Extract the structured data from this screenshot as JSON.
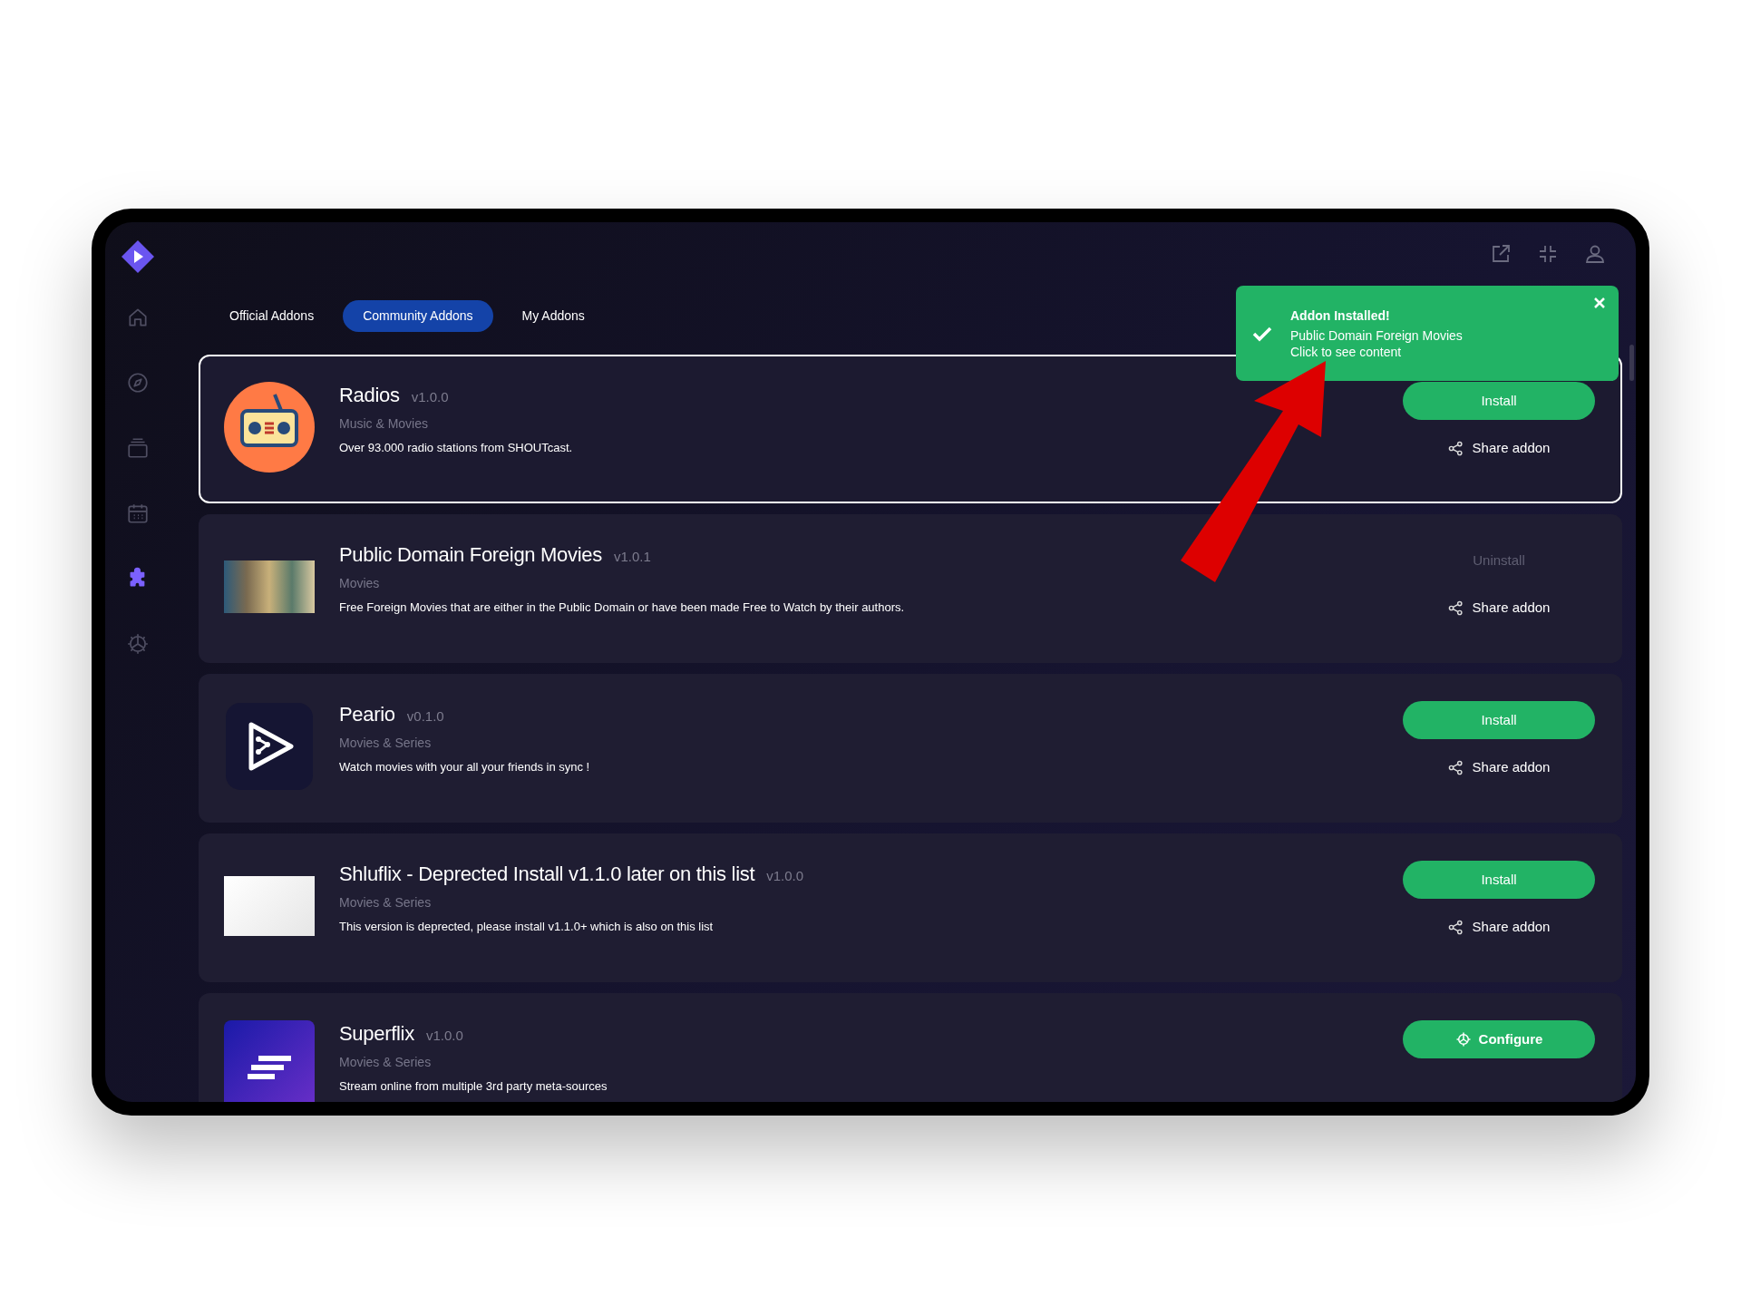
{
  "sidebar": {
    "items": [
      {
        "kind": "home",
        "selected": false
      },
      {
        "kind": "discover",
        "selected": false
      },
      {
        "kind": "library",
        "selected": false
      },
      {
        "kind": "calendar",
        "selected": false
      },
      {
        "kind": "addons",
        "selected": true
      },
      {
        "kind": "settings",
        "selected": false
      }
    ]
  },
  "tabs": [
    {
      "label": "Official Addons",
      "selected": false
    },
    {
      "label": "Community Addons",
      "selected": true
    },
    {
      "label": "My Addons",
      "selected": false
    }
  ],
  "addons": [
    {
      "name": "Radios",
      "version": "v1.0.0",
      "category": "Music & Movies",
      "description": "Over 93.000 radio stations from SHOUTcast.",
      "kind": "radio",
      "selected": true,
      "action": {
        "kind": "install",
        "label": "Install"
      },
      "share": "Share addon"
    },
    {
      "name": "Public Domain Foreign Movies",
      "version": "v1.0.1",
      "category": "Movies",
      "description": "Free Foreign Movies that are either in the Public Domain or have been made Free to Watch by their authors.",
      "kind": "posters",
      "selected": false,
      "action": {
        "kind": "uninstall",
        "label": "Uninstall"
      },
      "share": "Share addon"
    },
    {
      "name": "Peario",
      "version": "v0.1.0",
      "category": "Movies & Series",
      "description": "Watch movies with your all your friends in sync !",
      "kind": "play",
      "selected": false,
      "action": {
        "kind": "install",
        "label": "Install"
      },
      "share": "Share addon"
    },
    {
      "name": "Shluflix - Deprected Install v1.1.0 later on this list",
      "version": "v1.0.0",
      "category": "Movies & Series",
      "description": "This version is deprected, please install v1.1.0+ which is also on this list",
      "kind": "photo",
      "selected": false,
      "action": {
        "kind": "install",
        "label": "Install"
      },
      "share": "Share addon"
    },
    {
      "name": "Superflix",
      "version": "v1.0.0",
      "category": "Movies & Series",
      "description": "Stream online from multiple 3rd party meta-sources",
      "kind": "lines",
      "selected": false,
      "action": {
        "kind": "configure",
        "label": "Configure"
      }
    }
  ],
  "toast": {
    "title": "Addon Installed!",
    "message": "Public Domain Foreign Movies",
    "link": "Click to see content"
  }
}
